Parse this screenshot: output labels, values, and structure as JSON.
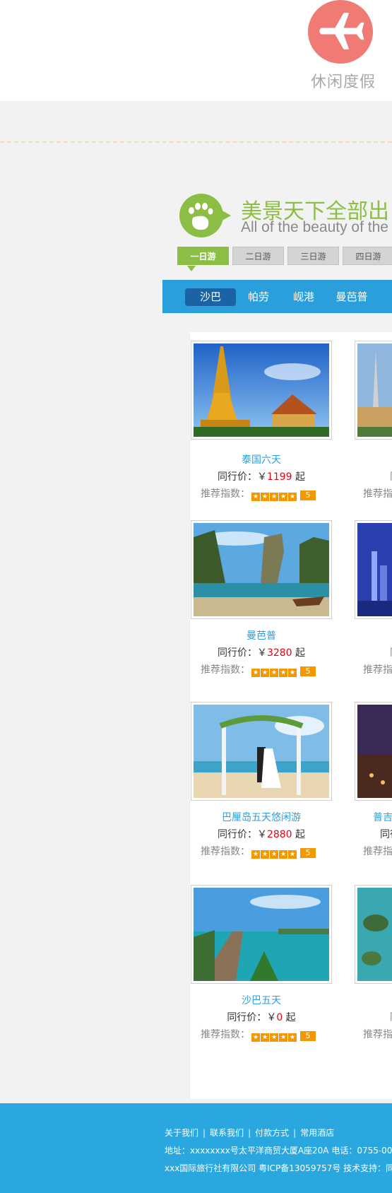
{
  "header": {
    "leisure_label": "休闲度假",
    "plane_icon": "plane-icon"
  },
  "brand": {
    "title": "美景天下全部出",
    "subtitle": "All of the beauty of the"
  },
  "day_tabs": [
    "一日游",
    "二日游",
    "三日游",
    "四日游"
  ],
  "city_tabs": [
    "沙巴",
    "帕劳",
    "岘港",
    "曼芭普"
  ],
  "cards": [
    {
      "title": "泰国六天",
      "price_label": "同行价：",
      "currency": "￥",
      "price": "1199",
      "price_suffix": " 起",
      "rating_label": "推荐指数：",
      "score": "5"
    },
    {
      "title": "曼芭普",
      "price_label": "同行价：",
      "currency": "￥",
      "price": "3280",
      "price_suffix": " 起",
      "rating_label": "推荐指数：",
      "score": "5"
    },
    {
      "title": "巴厘岛五天悠闲游",
      "price_label": "同行价：",
      "currency": "￥",
      "price": "2880",
      "price_suffix": " 起",
      "rating_label": "推荐指数：",
      "score": "5"
    },
    {
      "title": "沙巴五天",
      "price_label": "同行价：",
      "currency": "￥",
      "price": "0",
      "price_suffix": " 起",
      "rating_label": "推荐指数：",
      "score": "5"
    }
  ],
  "partial_cards": [
    {
      "line1": "同",
      "line2": "推荐指"
    },
    {
      "line1": "同",
      "line2": "推荐指"
    },
    {
      "line0": "普吉",
      "line1": "同行",
      "line2": "推荐指"
    },
    {
      "line1": "同",
      "line2": "推荐指"
    }
  ],
  "footer": {
    "links": [
      "关于我们",
      "联系我们",
      "付款方式",
      "常用酒店"
    ],
    "separator": "|",
    "address": "地址：xxxxxxxx号太平洋商贸大厦A座20A  电话：0755-000",
    "copyright": "xxx国际旅行社有限公司  粤ICP备13059757号  技术支持：同"
  },
  "colors": {
    "accent_green": "#8cbd45",
    "accent_blue": "#2b9fdc",
    "price_red": "#e60012",
    "star_orange": "#f39800",
    "badge_coral": "#ef7b74"
  }
}
